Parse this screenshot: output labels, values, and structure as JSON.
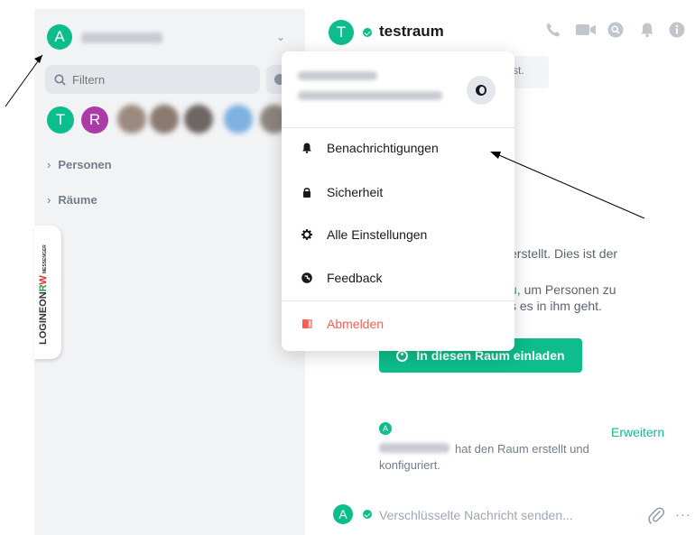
{
  "left_panel": {
    "user_avatar_letter": "A",
    "filter_placeholder": "Filtern",
    "room_avatars": [
      "T",
      "R"
    ],
    "sections": [
      "Personen",
      "Räume"
    ],
    "brand": {
      "logineo": "LOGINEO",
      "n": "N",
      "r": "R",
      "w": "W",
      "messenger": "MESSENGER"
    }
  },
  "room": {
    "avatar_letter": "T",
    "title": "testraum",
    "header_icons": [
      "phone-icon",
      "video-icon",
      "search-icon",
      "bell-icon",
      "info-icon"
    ]
  },
  "timeline": {
    "notice_text": "st.",
    "creation_lines": [
      "erstellt. Dies ist der",
      ".",
      "u",
      ", um Personen zu",
      "s es in ihm geht."
    ],
    "invite_label": "In diesen Raum einladen",
    "event_avatar_letter": "A",
    "expand_label": "Erweitern",
    "event_text": "hat den Raum erstellt und",
    "event_text2": "konfiguriert."
  },
  "composer": {
    "avatar_letter": "A",
    "placeholder": "Verschlüsselte Nachricht senden...",
    "more": "···"
  },
  "menu": {
    "items": [
      {
        "label": "Benachrichtigungen",
        "icon": "bell-icon"
      },
      {
        "label": "Sicherheit",
        "icon": "lock-icon"
      },
      {
        "label": "Alle Einstellungen",
        "icon": "gear-icon"
      },
      {
        "label": "Feedback",
        "icon": "feedback-icon"
      },
      {
        "label": "Abmelden",
        "icon": "signout-icon"
      }
    ]
  },
  "colors": {
    "accent": "#0dbd8b",
    "danger": "#ff5b55",
    "sidebar_bg": "#f2f3f5",
    "avatar_purple": "#ac3ba8"
  }
}
